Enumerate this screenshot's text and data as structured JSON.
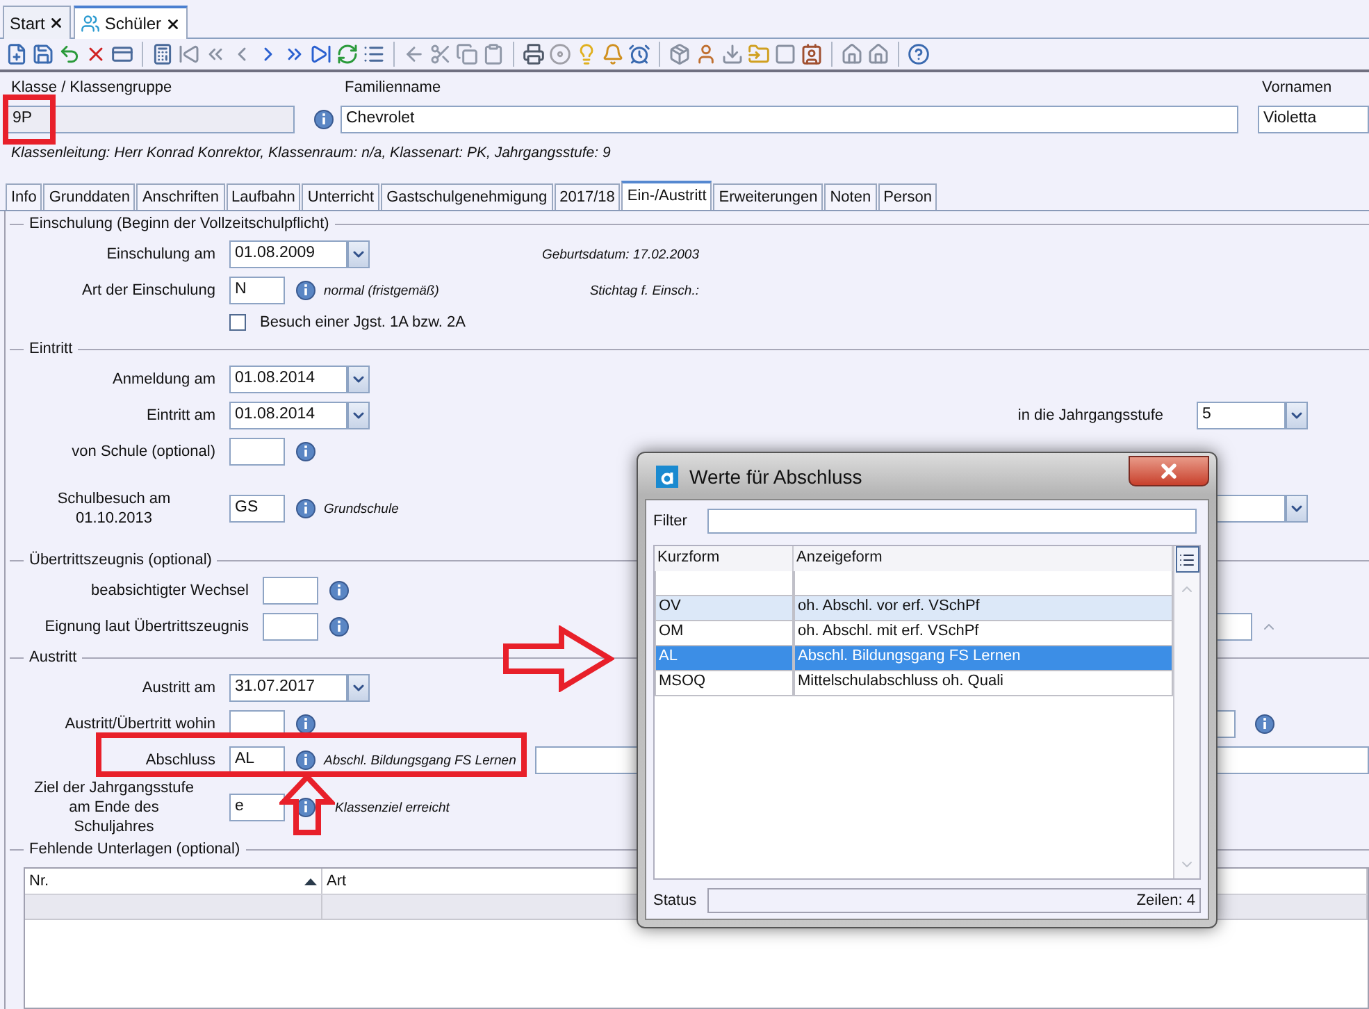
{
  "doc_tabs": [
    {
      "label": "Start",
      "selected": false
    },
    {
      "label": "Schüler",
      "selected": true
    }
  ],
  "header": {
    "class_label": "Klasse / Klassengruppe",
    "class_value": "9P",
    "family_label": "Familienname",
    "family_value": "Chevrolet",
    "first_label": "Vornamen",
    "first_value": "Violetta",
    "info_line": "Klassenleitung: Herr Konrad Konrektor, Klassenraum: n/a, Klassenart: PK, Jahrgangsstufe: 9"
  },
  "tabs": [
    {
      "label": "Info",
      "selected": false
    },
    {
      "label": "Grunddaten",
      "selected": false
    },
    {
      "label": "Anschriften",
      "selected": false
    },
    {
      "label": "Laufbahn",
      "selected": false
    },
    {
      "label": "Unterricht",
      "selected": false
    },
    {
      "label": "Gastschulgenehmigung",
      "selected": false
    },
    {
      "label": "2017/18",
      "selected": false
    },
    {
      "label": "Ein-/Austritt",
      "selected": true
    },
    {
      "label": "Erweiterungen",
      "selected": false
    },
    {
      "label": "Noten",
      "selected": false
    },
    {
      "label": "Person",
      "selected": false
    }
  ],
  "sections": [
    {
      "title": "Einschulung (Beginn der Vollzeitschulpflicht)",
      "rows": [
        {
          "kind": "date",
          "label": "Einschulung am",
          "value": "01.08.2009",
          "aside": {
            "kind": "text",
            "text": "Geburtsdatum: 17.02.2003"
          }
        },
        {
          "kind": "code",
          "label": "Art der Einschulung",
          "value": "N",
          "note": "normal (fristgemäß)",
          "aside": {
            "kind": "text",
            "text": "Stichtag f. Einsch.:"
          }
        },
        {
          "kind": "checkbox",
          "label": "Besuch einer Jgst. 1A bzw. 2A",
          "checked": false
        }
      ]
    },
    {
      "title": "Eintritt",
      "rows": [
        {
          "kind": "date",
          "label": "Anmeldung am",
          "value": "01.08.2014"
        },
        {
          "kind": "date",
          "label": "Eintritt am",
          "value": "01.08.2014",
          "aside": {
            "kind": "select",
            "label": "in die Jahrgangsstufe",
            "value": "5"
          }
        },
        {
          "kind": "code",
          "label": "von Schule (optional)"
        },
        {
          "kind": "code",
          "label": "Schulbesuch am 01.10.2013",
          "wrapped": true,
          "value": "GS",
          "note": "Grundschule",
          "aside": {
            "kind": "select"
          }
        }
      ]
    },
    {
      "title": "Übertrittszeugnis (optional)",
      "rows": [
        {
          "kind": "code",
          "label": "beabsichtigter Wechsel"
        },
        {
          "kind": "code",
          "label": "Eignung laut Übertrittszeugnis",
          "aside": {
            "kind": "spinner"
          }
        }
      ]
    },
    {
      "title": "Austritt",
      "rows": [
        {
          "kind": "date",
          "label": "Austritt am",
          "value": "31.07.2017"
        },
        {
          "kind": "code",
          "label": "Austritt/Übertritt wohin",
          "aside": {
            "kind": "field_info"
          }
        },
        {
          "kind": "code",
          "label": "Abschluss",
          "value": "AL",
          "note": "Abschl. Bildungsgang FS Lernen",
          "aside": {
            "kind": "field"
          }
        },
        {
          "kind": "code",
          "label": "Ziel der Jahrgangsstufe am Ende des Schuljahres",
          "wrapped": true,
          "value": "e",
          "note": "Klassenziel erreicht"
        }
      ]
    }
  ],
  "documents": {
    "title": "Fehlende Unterlagen (optional)",
    "columns": [
      "Nr.",
      "Art"
    ]
  },
  "dialog": {
    "title": "Werte für Abschluss",
    "filter_label": "Filter",
    "columns": [
      "Kurzform",
      "Anzeigeform"
    ],
    "rows": [
      {
        "short": "OV",
        "display": "oh. Abschl. vor erf. VSchPf",
        "selected": false,
        "hovered": true
      },
      {
        "short": "OM",
        "display": "oh. Abschl. mit erf. VSchPf",
        "selected": false,
        "hovered": false
      },
      {
        "short": "AL",
        "display": "Abschl. Bildungsgang FS Lernen",
        "selected": true,
        "hovered": false
      },
      {
        "short": "MSOQ",
        "display": "Mittelschulabschluss oh. Quali",
        "selected": false,
        "hovered": false
      }
    ],
    "status_label": "Status",
    "row_count": "Zeilen: 4"
  }
}
